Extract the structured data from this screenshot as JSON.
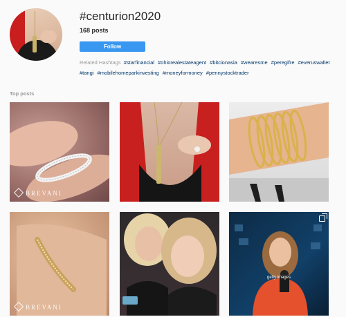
{
  "header": {
    "title": "#centurion2020",
    "post_count": "168",
    "post_count_suffix": "posts",
    "follow_label": "Follow"
  },
  "related": {
    "label": "Related Hashtags",
    "tags": [
      "#starfinancial",
      "#ohiorealestateagent",
      "#bitcionasia",
      "#wearesme",
      "#peregifre",
      "#everuswallet",
      "#tangi",
      "#mobilehomeparkinvesting",
      "#moneyformoney",
      "#pennystocktrader"
    ]
  },
  "top_posts": {
    "label": "Top posts",
    "watermark": "BREVANI",
    "tv_caption": "getty images"
  },
  "colors": {
    "accent": "#3897f0",
    "hashtag_link": "#003569",
    "muted": "#999999"
  }
}
